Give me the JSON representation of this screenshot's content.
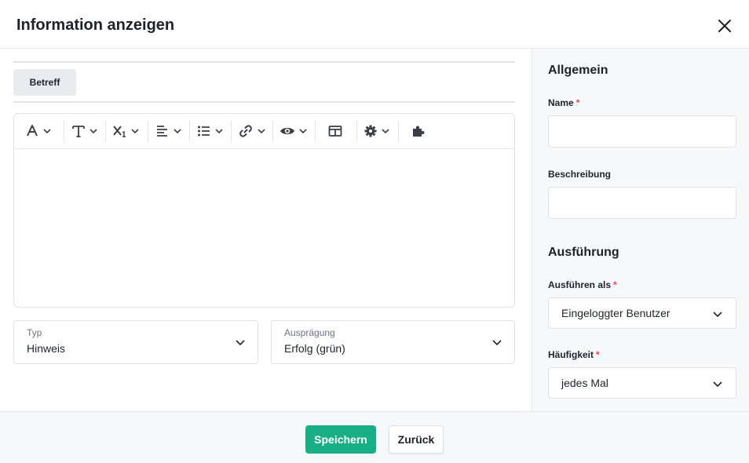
{
  "dialog": {
    "title": "Information anzeigen",
    "close_icon": "close-icon"
  },
  "editor": {
    "subject_button": "Betreff",
    "toolbar_icons": [
      "font-color-icon",
      "text-format-icon",
      "subscript-icon",
      "align-left-icon",
      "list-icon",
      "link-icon",
      "preview-icon",
      "table-icon",
      "settings-icon",
      "plugin-icon"
    ]
  },
  "fields": {
    "type": {
      "label": "Typ",
      "value": "Hinweis"
    },
    "variant": {
      "label": "Ausprägung",
      "value": "Erfolg (grün)"
    }
  },
  "sidebar": {
    "general_title": "Allgemein",
    "name_label": "Name",
    "name_value": "",
    "description_label": "Beschreibung",
    "description_value": "",
    "execution_title": "Ausführung",
    "run_as_label": "Ausführen als",
    "run_as_value": "Eingeloggter Benutzer",
    "frequency_label": "Häufigkeit",
    "frequency_value": "jedes Mal",
    "required_mark": "*"
  },
  "footer": {
    "save_label": "Speichern",
    "back_label": "Zurück"
  },
  "colors": {
    "primary": "#1aae86",
    "required": "#e5484d"
  }
}
